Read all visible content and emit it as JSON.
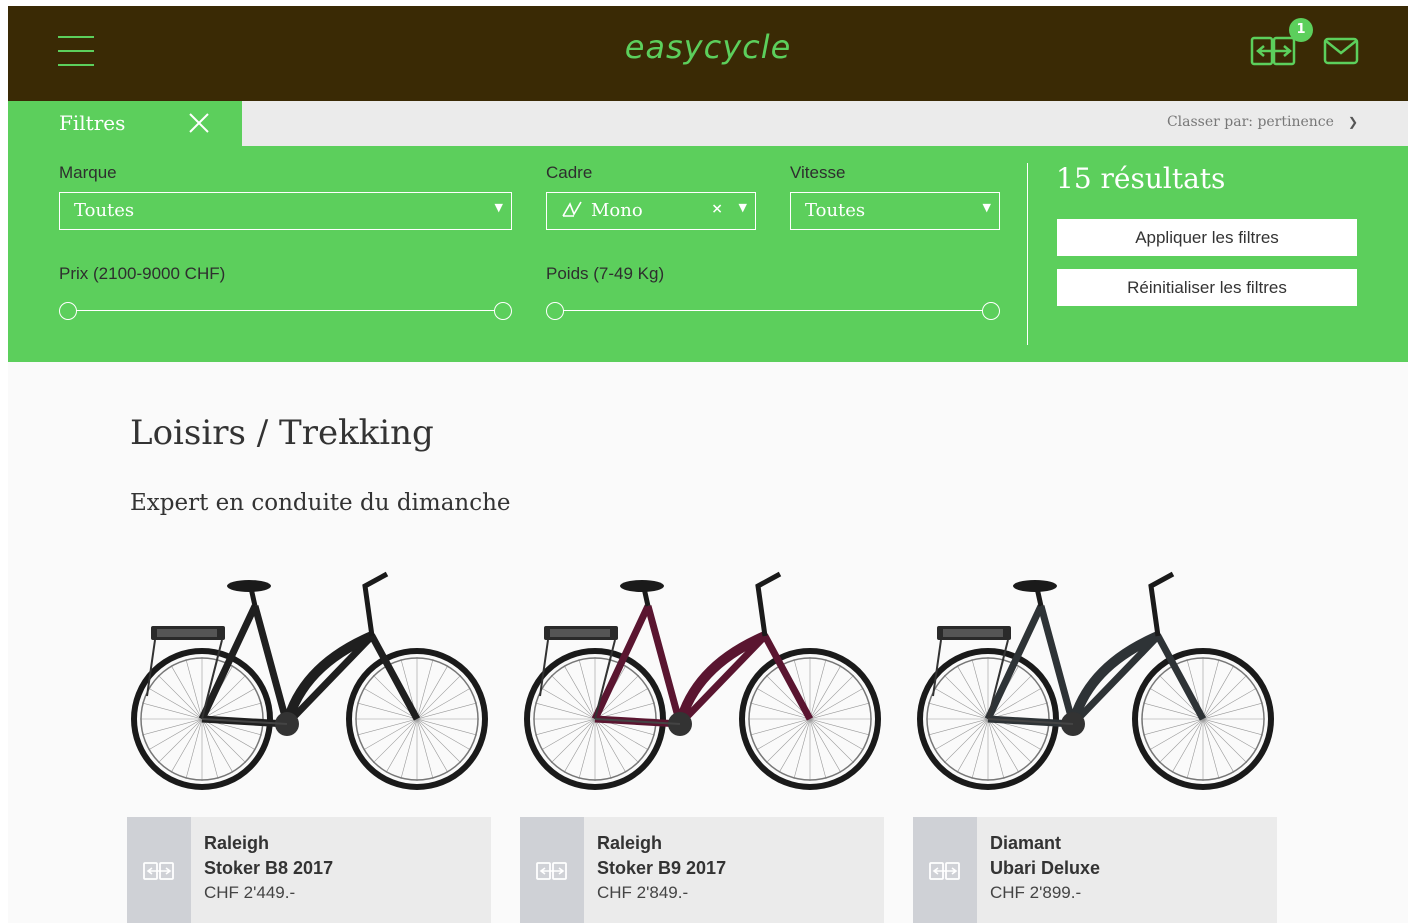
{
  "header": {
    "logo": "easycycle",
    "compare_count": "1",
    "icons": [
      "menu-icon",
      "compare-icon",
      "mail-icon"
    ]
  },
  "filterbar": {
    "tab_label": "Filtres",
    "sort_label": "Classer par: pertinence"
  },
  "filters": {
    "brand": {
      "label": "Marque",
      "value": "Toutes"
    },
    "frame": {
      "label": "Cadre",
      "value": "Mono"
    },
    "speed": {
      "label": "Vitesse",
      "value": "Toutes"
    },
    "price": {
      "label": "Prix (2100-9000 CHF)"
    },
    "weight": {
      "label": "Poids (7-49 Kg)"
    },
    "results": "15 résultats",
    "apply_label": "Appliquer les filtres",
    "reset_label": "Réinitialiser les filtres"
  },
  "section": {
    "title": "Loisirs / Trekking",
    "subtitle": "Expert en conduite du dimanche"
  },
  "products": [
    {
      "brand": "Raleigh",
      "model": "Stoker B8 2017",
      "price": "CHF 2'449.-",
      "frame_color": "#1f1f1f"
    },
    {
      "brand": "Raleigh",
      "model": "Stoker B9 2017",
      "price": "CHF 2'849.-",
      "frame_color": "#5a1530"
    },
    {
      "brand": "Diamant",
      "model": "Ubari Deluxe",
      "price": "CHF 2'899.-",
      "frame_color": "#2e3336"
    }
  ],
  "colors": {
    "header_bg": "#3a2a05",
    "accent": "#5ccf5c",
    "info_bg": "#ebebeb",
    "compare_bg": "#cfd1d6"
  }
}
